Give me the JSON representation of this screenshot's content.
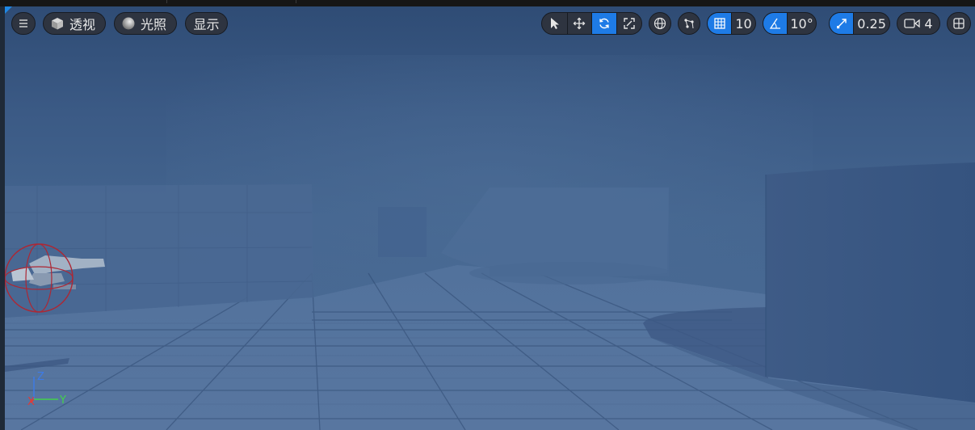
{
  "toolbar": {
    "menu_icon": "hamburger-menu-icon",
    "view_mode_label": "透视",
    "lighting_label": "光照",
    "show_label": "显示",
    "transform_tools": [
      "select-icon",
      "move-icon",
      "rotate-icon",
      "scale-icon"
    ],
    "active_transform_tool": "rotate",
    "grid_snap_value": "10",
    "rotation_snap_value": "10°",
    "scale_snap_value": "0.25",
    "camera_speed_value": "4"
  },
  "gizmo": {
    "z_label": "Z",
    "x_label": "X",
    "y_label": "Y"
  },
  "colors": {
    "accent": "#1e7be6",
    "toolbar_bg": "#2e3440",
    "fog": "#3e5f8a",
    "axis_x": "#e53935",
    "axis_y": "#43d14a",
    "axis_z": "#3d7be8"
  }
}
